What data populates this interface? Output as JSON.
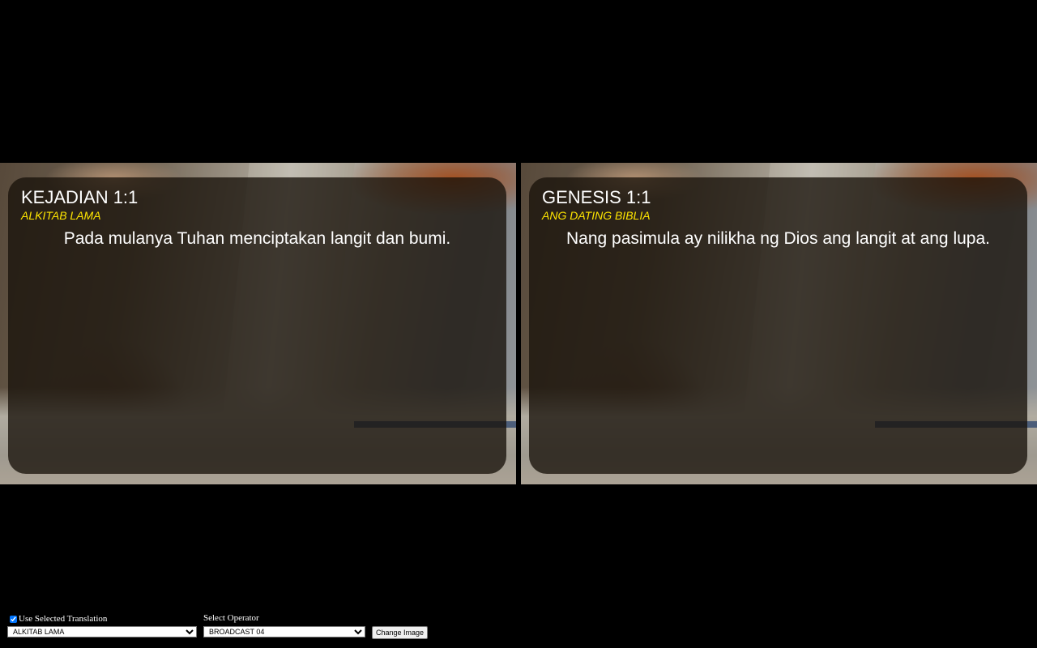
{
  "panels": [
    {
      "reference": "KEJADIAN 1:1",
      "version": "ALKITAB LAMA",
      "verse": "Pada mulanya Tuhan menciptakan langit dan bumi."
    },
    {
      "reference": "GENESIS 1:1",
      "version": "ANG DATING BIBLIA",
      "verse": "Nang pasimula ay nilikha ng Dios ang langit at ang lupa."
    }
  ],
  "controls": {
    "use_selected_translation_label": "Use Selected Translation",
    "use_selected_translation_checked": true,
    "translation_selected": "ALKITAB LAMA",
    "select_operator_label": "Select Operator",
    "operator_selected": "BROADCAST 04",
    "change_image_label": "Change Image"
  },
  "colors": {
    "background": "#000000",
    "reference_text": "#ffffff",
    "version_text": "#ffe600",
    "overlay": "rgba(24,18,10,0.78)"
  }
}
